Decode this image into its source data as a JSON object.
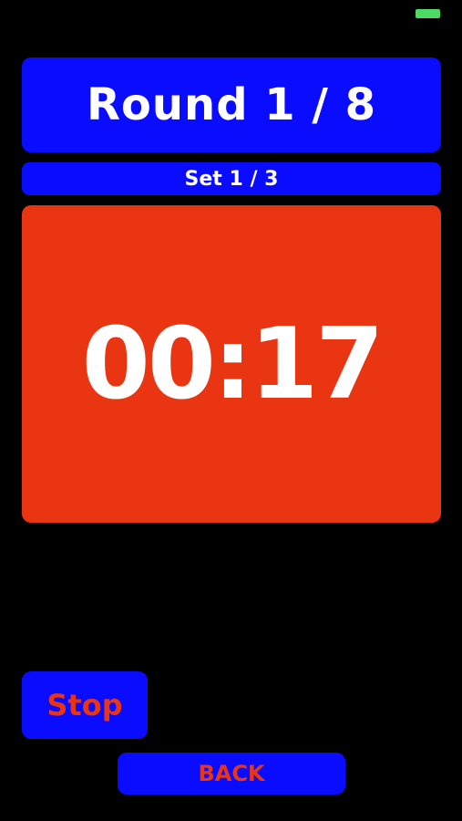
{
  "colors": {
    "background": "#000000",
    "panel_blue": "#0a0cff",
    "timer_red": "#e93512",
    "text_white": "#ffffff",
    "button_text_red": "#e93512",
    "battery_green": "#4cd964"
  },
  "status_bar": {
    "battery_icon": "battery-icon"
  },
  "round": {
    "label": "Round 1 / 8"
  },
  "set": {
    "label": "Set 1 / 3"
  },
  "timer": {
    "value": "00:17"
  },
  "controls": {
    "stop_label": "Stop",
    "back_label": "BACK"
  }
}
